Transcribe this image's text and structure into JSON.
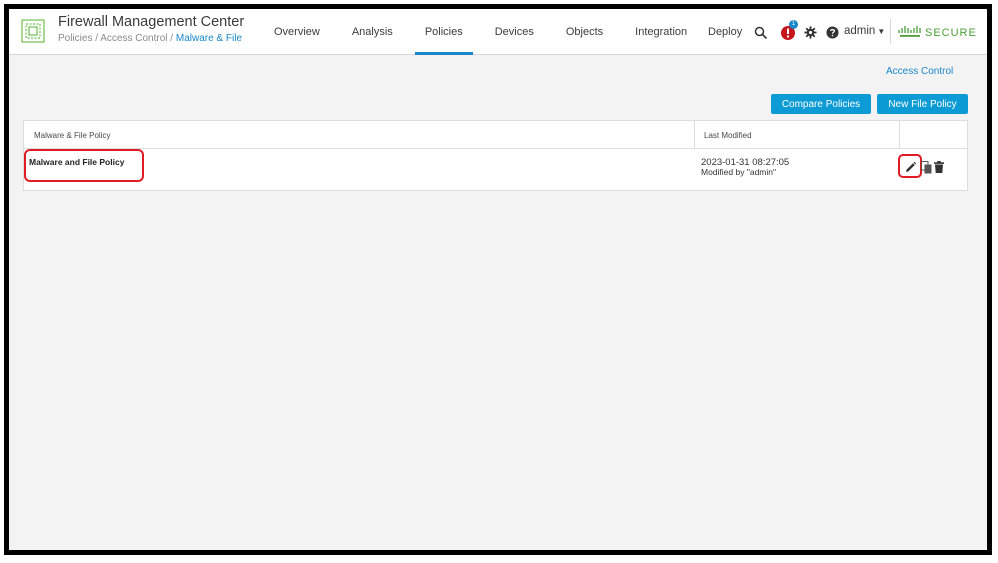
{
  "app": {
    "title": "Firewall Management Center",
    "breadcrumb": {
      "part1": "Policies",
      "sep": " / ",
      "part2": "Access Control",
      "current": "Malware & File"
    }
  },
  "nav": {
    "items": [
      {
        "label": "Overview",
        "name": "overview"
      },
      {
        "label": "Analysis",
        "name": "analysis"
      },
      {
        "label": "Policies",
        "name": "policies"
      },
      {
        "label": "Devices",
        "name": "devices"
      },
      {
        "label": "Objects",
        "name": "objects"
      },
      {
        "label": "Integration",
        "name": "integration"
      }
    ],
    "active": "Policies"
  },
  "header_actions": {
    "deploy_label": "Deploy",
    "alert_count": "1",
    "user": "admin",
    "brand_text": "SECURE"
  },
  "page": {
    "access_control_link": "Access Control",
    "compare_button": "Compare Policies",
    "new_button": "New File Policy"
  },
  "table": {
    "columns": [
      "Malware & File Policy",
      "Last Modified"
    ],
    "rows": [
      {
        "name": "Malware and File Policy",
        "modified": "2023-01-31 08:27:05",
        "modified_by": "Modified by \"admin\""
      }
    ]
  },
  "colors": {
    "accent": "#1a87c9",
    "button": "#0d9bd5",
    "highlight": "#e01b24",
    "brand_green": "#4c9f38",
    "background": "#f3f3f3"
  },
  "icons": [
    "fmc-logo-icon",
    "search-icon",
    "alert-icon",
    "gear-icon",
    "help-icon",
    "cisco-logo-icon",
    "pencil-icon",
    "copy-icon",
    "trash-icon"
  ]
}
